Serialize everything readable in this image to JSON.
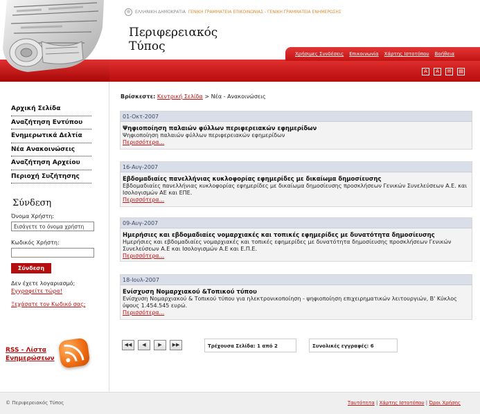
{
  "header": {
    "ministry": "ΕΛΛΗΝΙΚΗ ΔΗΜΟΚΡΑΤΙΑ",
    "secretariats": "ΓΕΝΙΚΗ ΓΡΑΜΜΑΤΕΙΑ ΕΠΙΚΟΙΝΩΝΙΑΣ - ΓΕΝΙΚΗ ΓΡΑΜΜΑΤΕΙΑ ΕΝΗΜΕΡΩΣΗΣ",
    "title_line1": "Περιφερειακός",
    "title_line2": "Τύπος",
    "links": [
      "Χρήσιμες Συνδέσεις",
      "Επικοινωνία",
      "Χάρτης Ιστοτόπου",
      "Βοήθεια"
    ]
  },
  "sidebar": {
    "menu": [
      "Αρχική Σελίδα",
      "Αναζήτηση Εντύπου",
      "Ενημερωτικά Δελτία",
      "Νέα Ανακοινώσεις",
      "Αναζήτηση Αρχείου",
      "Περιοχή Συζήτησης"
    ],
    "login_title": "Σύνδεση",
    "username_label": "Όνομα Χρήστη:",
    "username_value": "Εισάγετε το όνομα χρήστη",
    "password_label": "Κωδικός Χρήστη:",
    "login_button": "Σύνδεση",
    "no_account": "Δεν έχετε λογαριασμό;",
    "register_link": "Εγγραφείτε τώρα!",
    "forgot_link": "Ξεχάσατε τον Κωδικό σας;",
    "rss_line1": "RSS - Λίστα",
    "rss_line2": "Ενημερώσεων"
  },
  "main": {
    "breadcrumb_label": "Βρίσκεστε:",
    "breadcrumb_home": "Κεντρική Σελίδα",
    "breadcrumb_rest": "> Νέα - Ανακοινώσεις",
    "more_label": "Περισσότερα...",
    "news": [
      {
        "date": "01-Οκτ-2007",
        "title": "Ψηφιοποίηση παλαιών φύλλων περιφερειακών εφημερίδων",
        "desc": "Ψηφιοποίηση παλαιών φύλλων περιφερειακών εφημερίδων"
      },
      {
        "date": "16-Αυγ-2007",
        "title": "Εβδομαδιαίες πανελλήνιας κυκλοφορίας εφημερίδες με δικαίωμα δημοσίευσης",
        "desc": "Εβδομαδιαίες πανελλήνιας κυκλοφορίας εφημερίδες με δικαίωμα δημοσίευσης προσκλήσεων Γενικών Συνελεύσεων Α.Ε. και Ισολογισμών ΑΕ και ΕΠΕ."
      },
      {
        "date": "09-Αυγ-2007",
        "title": "Ημερήσιες και εβδομαδιαίες νομαρχιακές και τοπικές εφημερίδες με δυνατότητα δημοσίευσης",
        "desc": "Ημερήσιες και εβδομαδιαίες νομαρχιακές και τοπικές εφημερίδες με δυνατότητα δημοσίευσης προσκλήσεων Γενικών Συνελεύσεων Α.Ε και Ισολογισμών Α.Ε και Ε.Π.Ε."
      },
      {
        "date": "18-Ιουλ-2007",
        "title": "Ενίσχυση Νομαρχιακού &Τοπικού τύπου",
        "desc": "Ενίσχυση Νομαρχιακού & Τοπικού τύπου για ηλεκτρονικοποίηση - ψηφιοποίηση επιχειρηματικών λειτουργιών, Β' Κύκλος ύψους 1.454.545 ευρώ."
      }
    ],
    "pager": {
      "first": "◀◀",
      "prev": "◀",
      "next": "▶",
      "last": "▶▶",
      "current_page": "Τρέχουσα Σελίδα: 1 από 2",
      "total_records": "Συνολικές εγγραφές:  6"
    }
  },
  "footer": {
    "copyright": "© Περιφερειακός Τύπος",
    "links": [
      "Ταυτότητα",
      "Χάρτης Ιστοτόπου",
      "Όροι Χρήσης"
    ]
  },
  "colors": {
    "accent": "#c01010",
    "band": "#d42020",
    "date_bar": "#d9dee8"
  }
}
